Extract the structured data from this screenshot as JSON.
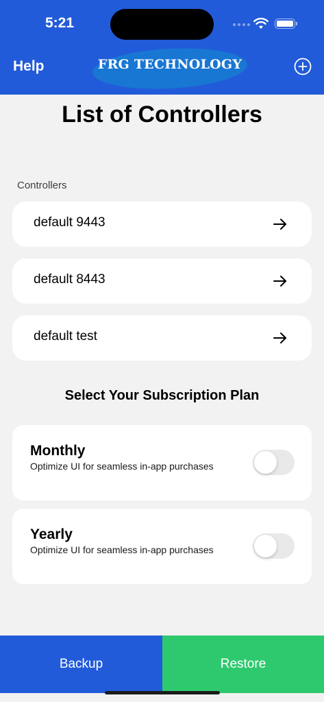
{
  "status_bar": {
    "time": "5:21",
    "icons": [
      "cellular-signal-icon",
      "wifi-icon",
      "battery-icon"
    ]
  },
  "nav": {
    "help_label": "Help",
    "logo_text": "FRG TECHNOLOGY",
    "add_icon": "plus-circle-icon"
  },
  "page_title": "List of Controllers",
  "controllers": {
    "section_label": "Controllers",
    "items": [
      {
        "label": "default 9443"
      },
      {
        "label": "default 8443"
      },
      {
        "label": "default test"
      }
    ]
  },
  "subscription": {
    "title": "Select Your Subscription Plan",
    "plans": [
      {
        "name": "Monthly",
        "description": "Optimize UI for seamless in-app purchases",
        "enabled": false
      },
      {
        "name": "Yearly",
        "description": "Optimize UI for seamless in-app purchases",
        "enabled": false
      }
    ]
  },
  "bottom": {
    "backup_label": "Backup",
    "restore_label": "Restore"
  },
  "colors": {
    "primary_blue": "#225bd9",
    "restore_green": "#2ec96e",
    "logo_blue": "#1877d3",
    "background": "#f2f2f2"
  }
}
